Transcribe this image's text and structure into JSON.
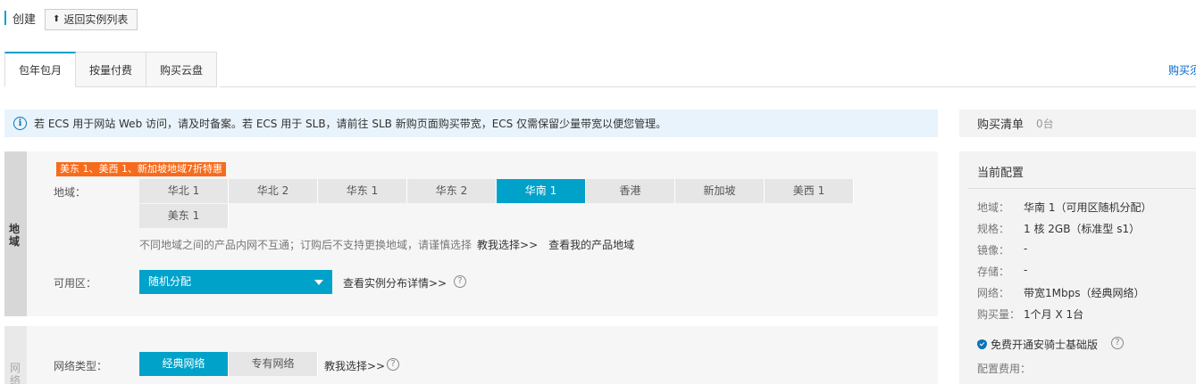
{
  "header": {
    "title": "创建",
    "back_label": "返回实例列表"
  },
  "tabs": [
    {
      "label": "包年包月",
      "active": true
    },
    {
      "label": "按量付费",
      "active": false
    },
    {
      "label": "购买云盘",
      "active": false
    }
  ],
  "top_right_link": "购买须",
  "notice": "若 ECS 用于网站 Web 访问，请及时备案。若 ECS 用于 SLB，请前往 SLB 新购页面购买带宽，ECS 仅需保留少量带宽以便您管理。",
  "region_section": {
    "side_label": "地域",
    "promo": "美东 1、美西 1、新加坡地域7折特惠",
    "region_label": "地域：",
    "regions_row1": [
      "华北 1",
      "华北 2",
      "华东 1",
      "华东 2",
      "华南 1",
      "香港",
      "新加坡",
      "美西 1"
    ],
    "regions_row2": [
      "美东 1"
    ],
    "selected_region": "华南 1",
    "hint": "不同地域之间的产品内网不互通；订购后不支持更换地域，请谨慎选择",
    "hint_link1": "教我选择>>",
    "hint_link2": "查看我的产品地域",
    "zone_label": "可用区：",
    "zone_value": "随机分配",
    "zone_link": "查看实例分布详情>>"
  },
  "network_section": {
    "side_label": "网络",
    "label": "网络类型：",
    "options": [
      "经典网络",
      "专有网络"
    ],
    "selected": "经典网络",
    "link": "教我选择>>"
  },
  "cart": {
    "title": "购买清单",
    "count": "0台"
  },
  "config": {
    "title": "当前配置",
    "items": [
      {
        "k": "地域：",
        "v": "华南 1（可用区随机分配）"
      },
      {
        "k": "规格：",
        "v": "1 核 2GB（标准型 s1）"
      },
      {
        "k": "镜像：",
        "v": "-"
      },
      {
        "k": "存储：",
        "v": "-"
      },
      {
        "k": "网络：",
        "v": "带宽1Mbps（经典网络）"
      },
      {
        "k": "购买量：",
        "v": "1个月 X 1台"
      }
    ],
    "free_service": "免费开通安骑士基础版",
    "fee_label": "配置费用："
  },
  "colors": {
    "accent": "#00a2ca",
    "promo": "#f76b1c",
    "notice_bg": "#e8f3fb"
  }
}
